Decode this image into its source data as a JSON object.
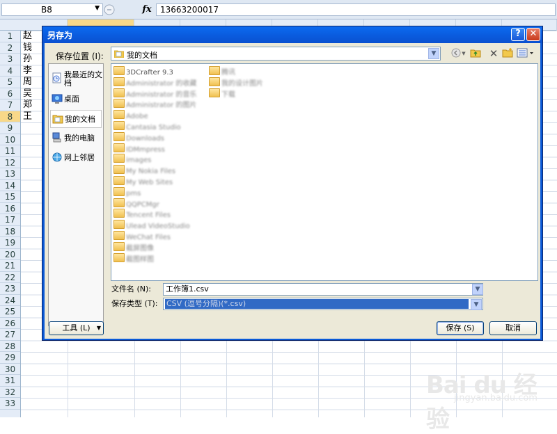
{
  "formula_bar": {
    "cell_ref": "B8",
    "fx_label": "fx",
    "formula_value": "13663200017"
  },
  "spreadsheet": {
    "rows": [
      "1",
      "2",
      "3",
      "4",
      "5",
      "6",
      "7",
      "8",
      "9",
      "10",
      "11",
      "12",
      "13",
      "14",
      "15",
      "16",
      "17",
      "18",
      "19",
      "20",
      "21",
      "22",
      "23",
      "24",
      "25",
      "26",
      "27",
      "28",
      "29",
      "30",
      "31",
      "32",
      "33"
    ],
    "selected_row": "8",
    "column_a_values": [
      "赵",
      "钱",
      "孙",
      "李",
      "周",
      "吴",
      "郑",
      "王"
    ]
  },
  "dialog": {
    "title": "另存为",
    "help_label": "?",
    "close_label": "✕",
    "save_in_label": "保存位置 (I):",
    "save_in_value": "我的文档",
    "places": [
      {
        "label": "我最近的文档",
        "icon": "recent-documents-icon"
      },
      {
        "label": "桌面",
        "icon": "desktop-icon"
      },
      {
        "label": "我的文档",
        "icon": "my-documents-icon"
      },
      {
        "label": "我的电脑",
        "icon": "my-computer-icon"
      },
      {
        "label": "网上邻居",
        "icon": "network-places-icon"
      }
    ],
    "selected_place": "我的文档",
    "files_col1": [
      "3DCrafter 9.3",
      "Administrator 的收藏",
      "Administrator 的音乐",
      "Administrator 的图片",
      "Adobe",
      "Cantasia Studio",
      "Downloads",
      "IDMmpress",
      "images",
      "My Nokia Files",
      "My Web Sites",
      "pms",
      "QQPCMgr",
      "Tencent Files",
      "Ulead VideoStudio",
      "WeChat Files",
      "截屏图像",
      "截图样图"
    ],
    "files_col2": [
      "腾讯",
      "我的设计图片",
      "下载"
    ],
    "filename_label": "文件名 (N):",
    "filename_value": "工作簿1.csv",
    "filetype_label": "保存类型 (T):",
    "filetype_value": "CSV (逗号分隔)(*.csv)",
    "tools_label": "工具 (L)",
    "save_label": "保存 (S)",
    "cancel_label": "取消"
  },
  "watermark": {
    "logo": "Bai du 经验",
    "sub": "jingyan.baidu.com"
  },
  "colors": {
    "title_bar": "#0a5ad8",
    "dialog_body": "#ece9d8",
    "selected_filetype": "#316ac5",
    "selected_row": "#f8d889"
  }
}
